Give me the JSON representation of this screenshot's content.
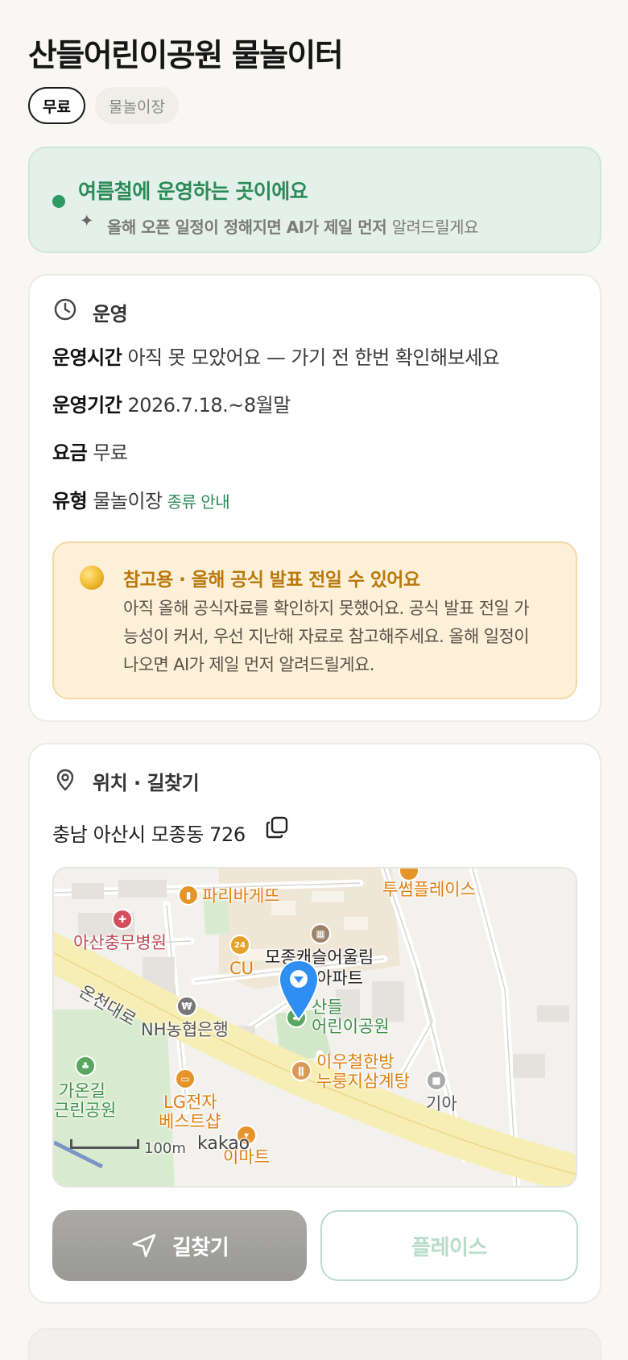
{
  "header": {
    "title": "산들어린이공원 물놀이터",
    "chips": [
      "무료",
      "물놀이장"
    ]
  },
  "season": {
    "headline": "여름철에 운영하는 곳이에요",
    "sub_bold": "올해 오픈 일정이 정해지면 AI가 제일 먼저",
    "sub_light": "알려드릴게요"
  },
  "operations": {
    "section_title": "운영",
    "rows": [
      {
        "label": "운영시간",
        "value": "아직 못 모았어요 — 가기 전 한번 확인해보세요"
      },
      {
        "label": "운영기간",
        "value": "2026.7.18.~8월말"
      },
      {
        "label": "요금",
        "value": "무료"
      },
      {
        "label": "유형",
        "value": "물놀이장",
        "link": "종류 안내"
      }
    ],
    "notice": {
      "title": "참고용 · 올해 공식 발표 전일 수 있어요",
      "body": "아직 올해 공식자료를 확인하지 못했어요. 공식 발표 전일 가능성이 커서, 우선 지난해 자료로 참고해주세요. 올해 일정이 나오면 AI가 제일 먼저 알려드릴게요."
    }
  },
  "location": {
    "section_title": "위치 · 길찾기",
    "address": "충남 아산시 모종동 726",
    "map": {
      "places": {
        "paris": "파리바게뜨",
        "twosome": "투썸플레이스",
        "hospital": "아산충무병원",
        "cu": "CU",
        "apt1": "모종캐슬어울림",
        "apt2": "아파트",
        "road": "온천대로",
        "bank": "NH농협은행",
        "park1": "산들",
        "park2": "어린이공원",
        "han1": "이우철한방",
        "han2": "누룽지삼계탕",
        "kia": "기아",
        "gaon1": "가온길",
        "gaon2": "근린공원",
        "lg1": "LG전자",
        "lg2": "베스트샵",
        "emart": "이마트"
      },
      "scale_label": "100m",
      "logo": "kakao"
    },
    "buttons": {
      "navigate": "길찾기",
      "place": "플레이스"
    }
  },
  "colors": {
    "accent_green": "#2b8a57",
    "notice_amber": "#b8780c",
    "page_bg": "#f8f7f3"
  }
}
